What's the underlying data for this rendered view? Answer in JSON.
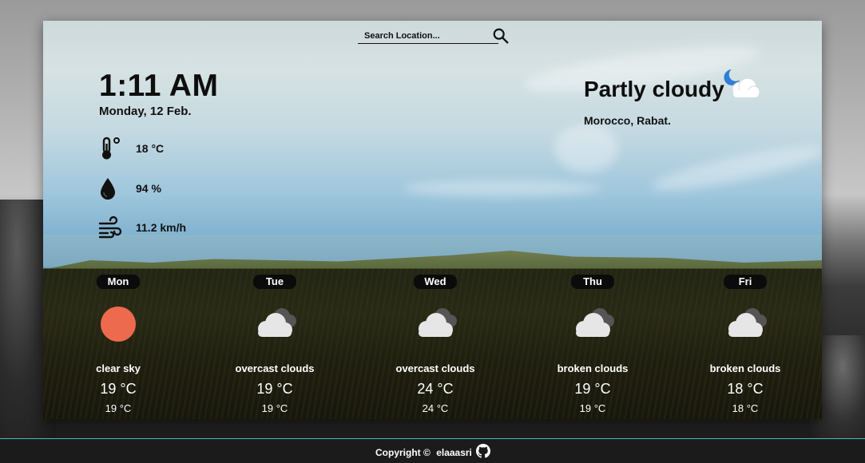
{
  "search": {
    "placeholder": "Search Location..."
  },
  "current": {
    "time": "1:11 AM",
    "date": "Monday, 12 Feb.",
    "temperature": "18 °C",
    "humidity": "94 %",
    "wind": "11.2 km/h",
    "condition": "Partly cloudy",
    "location": "Morocco, Rabat.",
    "condition_icon": "partly-cloudy-night-icon"
  },
  "forecast": [
    {
      "day": "Mon",
      "icon": "clear-sky-icon",
      "description": "clear sky",
      "temp": "19 °C",
      "temp_small": "19 °C"
    },
    {
      "day": "Tue",
      "icon": "overcast-clouds-icon",
      "description": "overcast clouds",
      "temp": "19 °C",
      "temp_small": "19 °C"
    },
    {
      "day": "Wed",
      "icon": "overcast-clouds-icon",
      "description": "overcast clouds",
      "temp": "24 °C",
      "temp_small": "24 °C"
    },
    {
      "day": "Thu",
      "icon": "broken-clouds-icon",
      "description": "broken clouds",
      "temp": "19 °C",
      "temp_small": "19 °C"
    },
    {
      "day": "Fri",
      "icon": "broken-clouds-icon",
      "description": "broken clouds",
      "temp": "18 °C",
      "temp_small": "18 °C"
    }
  ],
  "footer": {
    "copyright": "Copyright ©",
    "author": "elaaasri"
  },
  "colors": {
    "sun": "#ee6a4e",
    "footer_accent": "#4fb9bf",
    "moon": "#2e7fd6"
  }
}
